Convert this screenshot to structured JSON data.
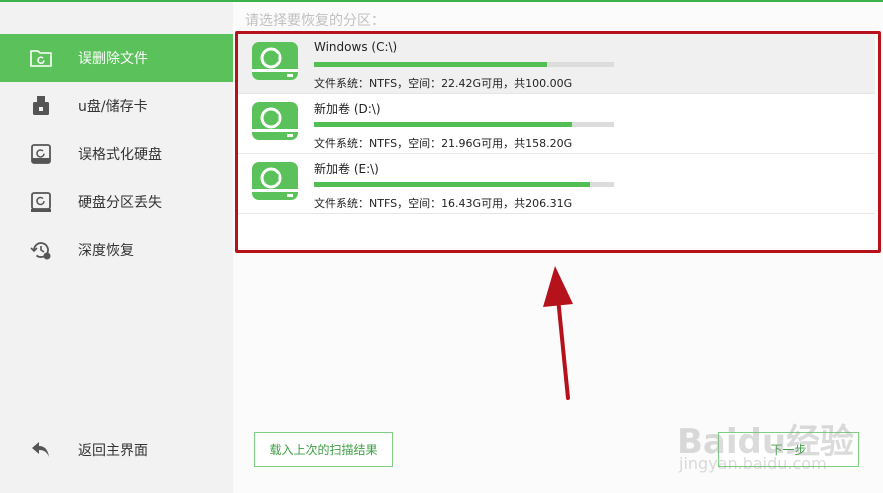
{
  "header": {
    "prompt": "请选择要恢复的分区："
  },
  "sidebar": {
    "items": [
      {
        "label": "误删除文件",
        "icon": "folder-recover-icon",
        "active": true
      },
      {
        "label": "u盘/储存卡",
        "icon": "usb-drive-icon",
        "active": false
      },
      {
        "label": "误格式化硬盘",
        "icon": "format-disk-icon",
        "active": false
      },
      {
        "label": "硬盘分区丢失",
        "icon": "partition-lost-icon",
        "active": false
      },
      {
        "label": "深度恢复",
        "icon": "deep-recovery-icon",
        "active": false
      }
    ],
    "back": {
      "label": "返回主界面",
      "icon": "return-arrow-icon"
    }
  },
  "partitions": [
    {
      "name": "Windows (C:\\)",
      "info": "文件系统：NTFS，空间：22.42G可用，共100.00G",
      "used_fraction": 0.776
    },
    {
      "name": "新加卷 (D:\\)",
      "info": "文件系统：NTFS，空间：21.96G可用，共158.20G",
      "used_fraction": 0.861
    },
    {
      "name": "新加卷 (E:\\)",
      "info": "文件系统：NTFS，空间：16.43G可用，共206.31G",
      "used_fraction": 0.92
    }
  ],
  "buttons": {
    "load_last": "载入上次的扫描结果",
    "next": "下一步"
  },
  "watermark": {
    "line1": "Baidu经验",
    "line2": "jingyan.baidu.com"
  },
  "colors": {
    "accent": "#5bc15a",
    "annotation": "#b5121b"
  }
}
